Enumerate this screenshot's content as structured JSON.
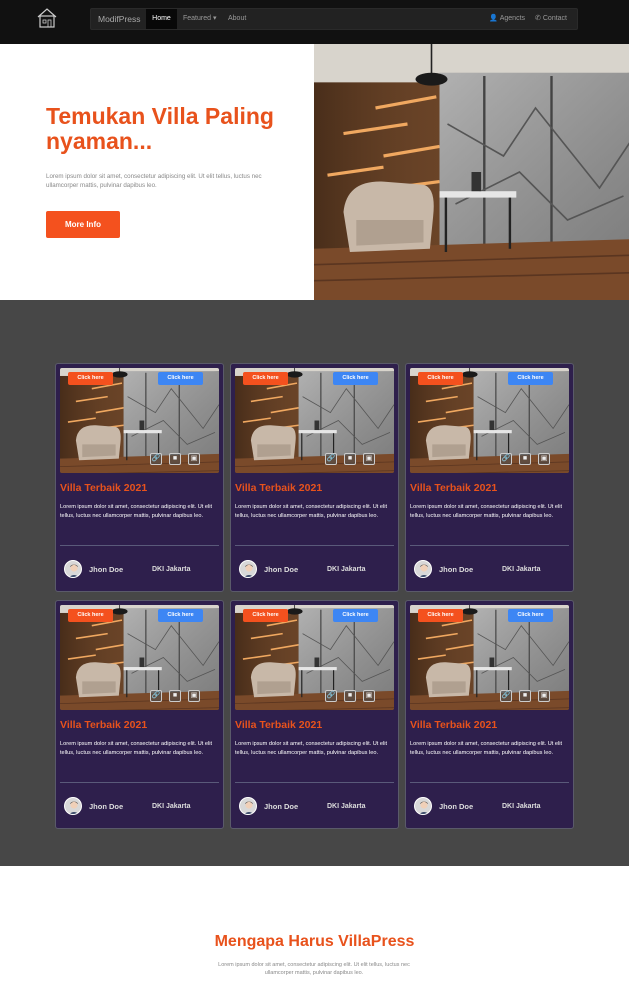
{
  "nav": {
    "brand": "ModifPress",
    "items": [
      {
        "label": "Home"
      },
      {
        "label": "Featured ▾"
      },
      {
        "label": "About"
      }
    ],
    "right": [
      {
        "label": "Agencts",
        "icon": "user-icon"
      },
      {
        "label": "Contact",
        "icon": "phone-icon"
      }
    ],
    "logo_icon": "house-logo-icon"
  },
  "hero": {
    "title": "Temukan Villa Paling nyaman...",
    "text": "Lorem ipsum dolor sit amet, consectetur adipiscing elit. Ut elit tellus, luctus nec ullamcorper mattis, pulvinar dapibus leo.",
    "button": "More Info"
  },
  "cards": [
    {
      "badge_left": "Click here",
      "badge_right": "Click here",
      "title": "Villa Terbaik 2021",
      "text": "Lorem ipsum dolor sit amet, consectetur adipiscing elit. Ut elit tellus, luctus nec ullamcorper mattis, pulvinar dapibus leo.",
      "author": "Jhon Doe",
      "location": "DKI Jakarta"
    },
    {
      "badge_left": "Click here",
      "badge_right": "Click here",
      "title": "Villa Terbaik 2021",
      "text": "Lorem ipsum dolor sit amet, consectetur adipiscing elit. Ut elit tellus, luctus nec ullamcorper mattis, pulvinar dapibus leo.",
      "author": "Jhon Doe",
      "location": "DKI Jakarta"
    },
    {
      "badge_left": "Click here",
      "badge_right": "Click here",
      "title": "Villa Terbaik 2021",
      "text": "Lorem ipsum dolor sit amet, consectetur adipiscing elit. Ut elit tellus, luctus nec ullamcorper mattis, pulvinar dapibus leo.",
      "author": "Jhon Doe",
      "location": "DKI Jakarta"
    },
    {
      "badge_left": "Click here",
      "badge_right": "Click here",
      "title": "Villa Terbaik 2021",
      "text": "Lorem ipsum dolor sit amet, consectetur adipiscing elit. Ut elit tellus, luctus nec ullamcorper mattis, pulvinar dapibus leo.",
      "author": "Jhon Doe",
      "location": "DKI Jakarta"
    },
    {
      "badge_left": "Click here",
      "badge_right": "Click here",
      "title": "Villa Terbaik 2021",
      "text": "Lorem ipsum dolor sit amet, consectetur adipiscing elit. Ut elit tellus, luctus nec ullamcorper mattis, pulvinar dapibus leo.",
      "author": "Jhon Doe",
      "location": "DKI Jakarta"
    },
    {
      "badge_left": "Click here",
      "badge_right": "Click here",
      "title": "Villa Terbaik 2021",
      "text": "Lorem ipsum dolor sit amet, consectetur adipiscing elit. Ut elit tellus, luctus nec ullamcorper mattis, pulvinar dapibus leo.",
      "author": "Jhon Doe",
      "location": "DKI Jakarta"
    }
  ],
  "card_icons": [
    "link-icon",
    "video-icon",
    "gallery-icon"
  ],
  "why": {
    "title": "Mengapa Harus VillaPress",
    "text": "Lorem ipsum dolor sit amet, consectetur adipiscing elit. Ut elit tellus, luctus nec ullamcorper mattis, pulvinar dapibus leo."
  },
  "colors": {
    "accent": "#e8521c",
    "button_orange": "#f4511e",
    "button_blue": "#3d86f4",
    "card_bg": "#2e1f4c",
    "section_bg": "#474747",
    "navbar_bg": "#111111"
  }
}
